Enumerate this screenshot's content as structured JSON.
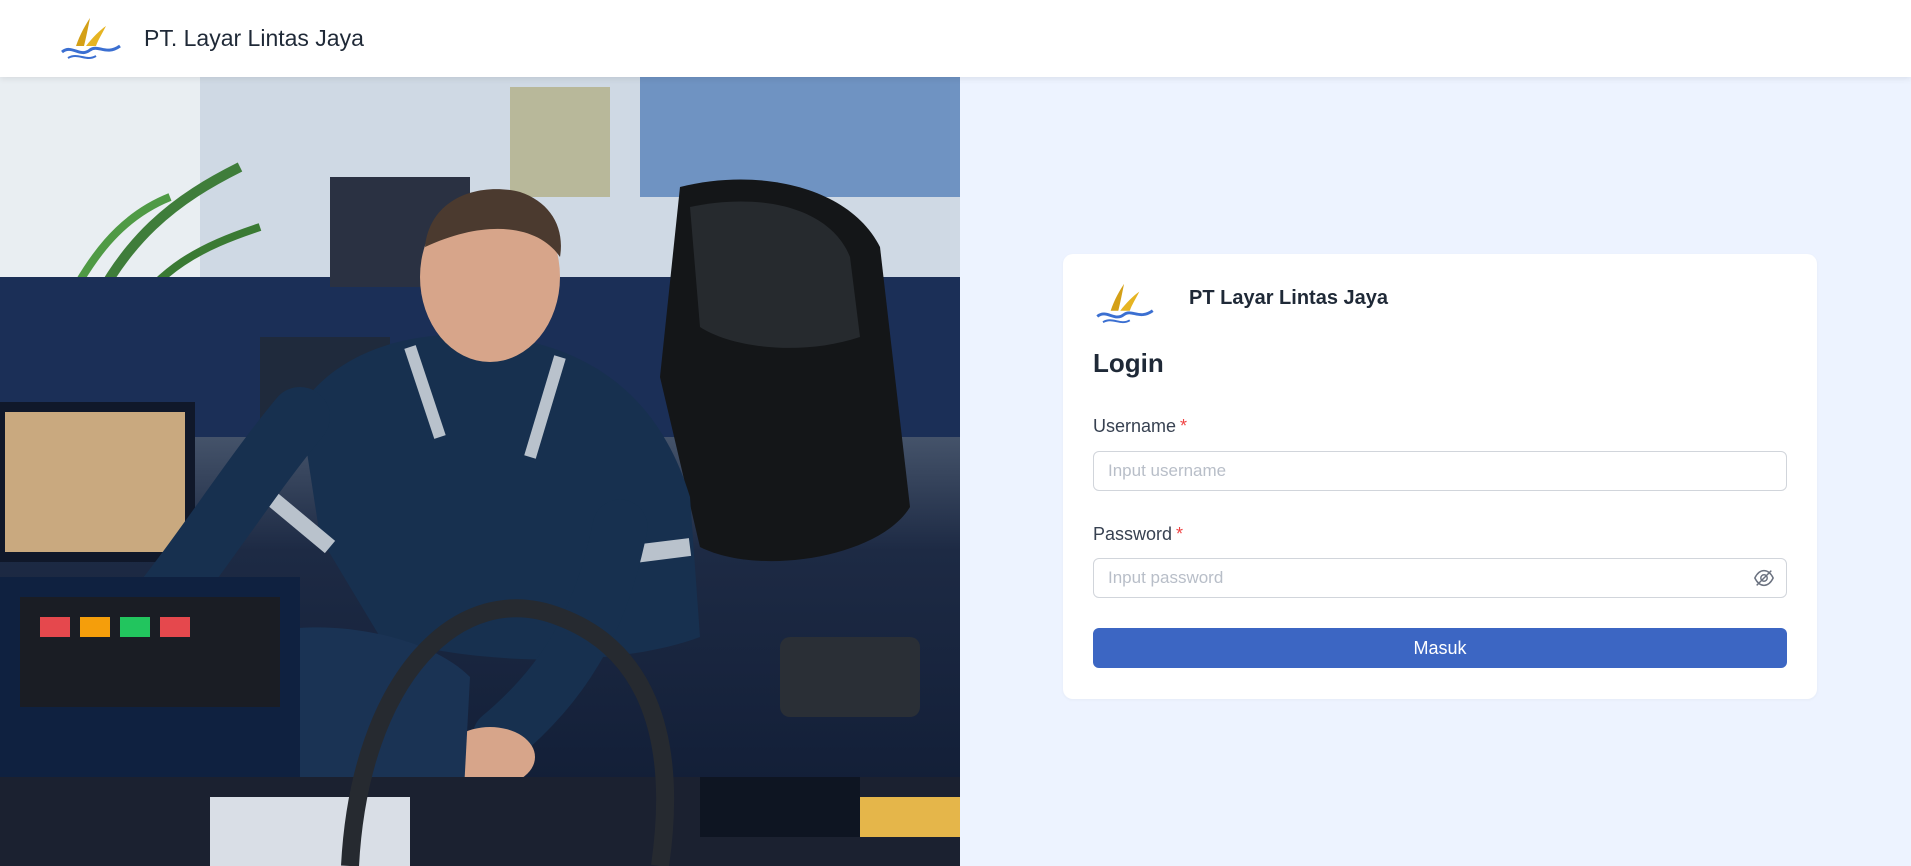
{
  "header": {
    "company_name": "PT. Layar Lintas Jaya",
    "logo": "sail-wave-logo"
  },
  "hero": {
    "image": "ship-bridge-officer-photo"
  },
  "login_card": {
    "brand_name": "PT Layar Lintas Jaya",
    "title": "Login",
    "username": {
      "label": "Username",
      "required_mark": "*",
      "placeholder": "Input username",
      "value": ""
    },
    "password": {
      "label": "Password",
      "required_mark": "*",
      "placeholder": "Input password",
      "value": "",
      "toggle_icon": "eye-off-icon"
    },
    "submit_label": "Masuk"
  },
  "colors": {
    "primary": "#3c66c3",
    "background": "#edf3ff",
    "required": "#ef4444",
    "logo_gold": "#d4a017",
    "logo_blue": "#3b6fd1"
  }
}
